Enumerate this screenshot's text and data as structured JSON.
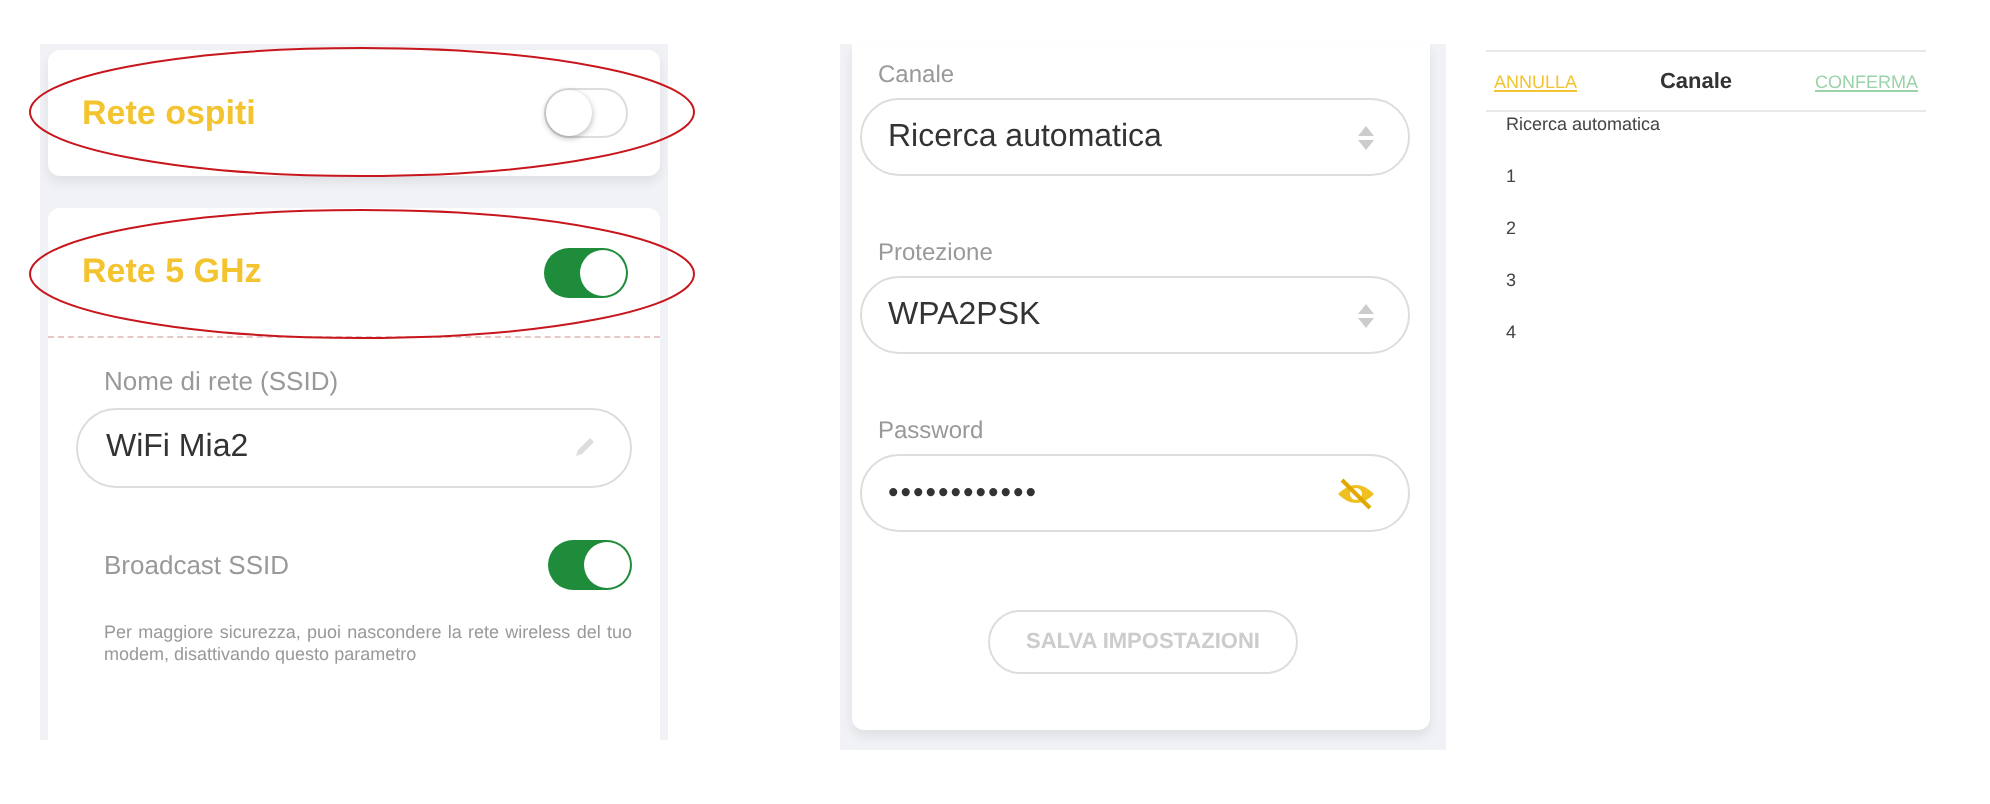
{
  "wifi_panel": {
    "guest_network": {
      "label": "Rete ospiti",
      "on": false,
      "highlighted": true
    },
    "band_5ghz": {
      "label": "Rete 5 GHz",
      "on": true,
      "highlighted": true
    },
    "ssid_field": {
      "label": "Nome di rete (SSID)",
      "value": "WiFi Mia2"
    },
    "broadcast": {
      "label": "Broadcast SSID",
      "on": true
    },
    "note": "Per maggiore sicurezza, puoi nascondere la rete wireless del tuo modem, disattivando questo parametro"
  },
  "settings_panel": {
    "fields": [
      {
        "kind": "select",
        "label": "Canale",
        "value": "Ricerca automatica"
      },
      {
        "kind": "select",
        "label": "Protezione",
        "value": "WPA2PSK"
      },
      {
        "kind": "password",
        "label": "Password",
        "value": "••••••••••••"
      }
    ],
    "save_button": {
      "label": "SALVA IMPOSTAZIONI",
      "disabled": true
    }
  },
  "picker": {
    "cancel": "ANNULLA",
    "title": "Canale",
    "confirm": "CONFERMA",
    "options": [
      {
        "label": "Ricerca automatica"
      },
      {
        "label": "1"
      },
      {
        "label": "2"
      },
      {
        "label": "3"
      },
      {
        "label": "4"
      }
    ]
  }
}
